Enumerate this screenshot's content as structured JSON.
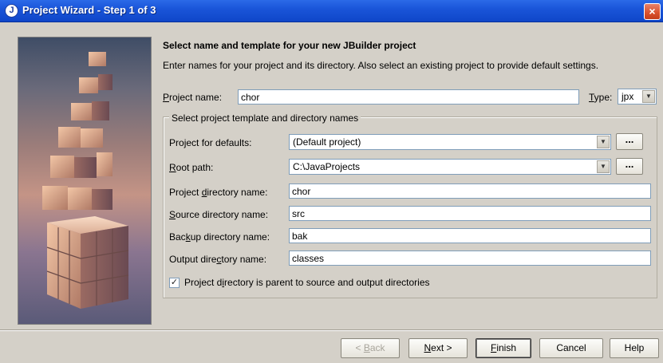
{
  "window": {
    "title": "Project Wizard - Step 1 of 3",
    "close_label": "×"
  },
  "header": {
    "heading": "Select name and template for your new JBuilder project",
    "subtext": "Enter names for your project and its directory. Also select an existing project to provide default settings."
  },
  "form": {
    "project_name": {
      "label_pre": "",
      "label_u": "P",
      "label_post": "roject name:",
      "value": "chor"
    },
    "type": {
      "label_u": "T",
      "label_post": "ype:",
      "value": "jpx"
    },
    "group_title": "Select project template and directory names",
    "project_defaults": {
      "label_pre": "Pro",
      "label_u": "j",
      "label_post": "ect for defaults:",
      "value": "(Default project)",
      "browse": "..."
    },
    "root_path": {
      "label_pre": "",
      "label_u": "R",
      "label_post": "oot path:",
      "value": "C:\\JavaProjects",
      "browse": "..."
    },
    "project_dir": {
      "label_pre": "Project ",
      "label_u": "d",
      "label_post": "irectory name:",
      "value": "chor"
    },
    "source_dir": {
      "label_pre": "",
      "label_u": "S",
      "label_post": "ource directory name:",
      "value": "src"
    },
    "backup_dir": {
      "label_pre": "Bac",
      "label_u": "k",
      "label_post": "up directory name:",
      "value": "bak"
    },
    "output_dir": {
      "label_pre": "Output dire",
      "label_u": "c",
      "label_post": "tory name:",
      "value": "classes"
    },
    "parent_checkbox": {
      "checked": true,
      "mark": "✓",
      "label_pre": "Project d",
      "label_u": "i",
      "label_post": "rectory is parent to source and output directories"
    }
  },
  "buttons": {
    "back": {
      "pre": "< ",
      "u": "B",
      "post": "ack"
    },
    "next": {
      "u": "N",
      "post": "ext >"
    },
    "finish": {
      "u": "F",
      "post": "inish"
    },
    "cancel": "Cancel",
    "help": "Help"
  },
  "icons": {
    "title_icon": "jbuilder-logo-icon",
    "dropdown": "chevron-down-icon"
  }
}
